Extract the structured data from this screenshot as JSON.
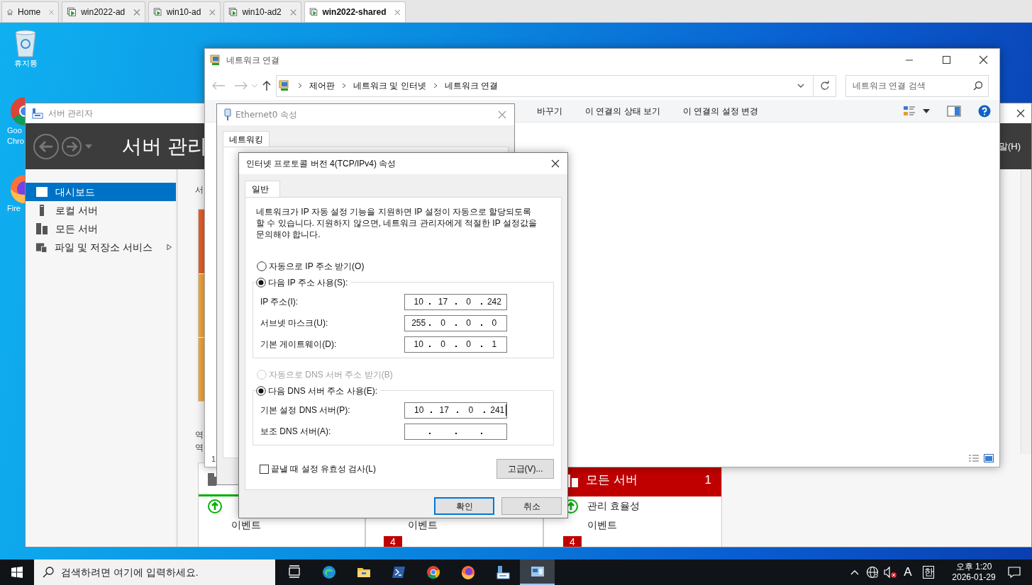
{
  "vm_tabs": [
    {
      "label": "Home",
      "kind": "home",
      "selected": false
    },
    {
      "label": "win2022-ad",
      "kind": "vm",
      "selected": false
    },
    {
      "label": "win10-ad",
      "kind": "vm",
      "selected": false
    },
    {
      "label": "win10-ad2",
      "kind": "vm",
      "selected": false
    },
    {
      "label": "win2022-shared",
      "kind": "vm",
      "selected": true
    }
  ],
  "desktop_icons": [
    {
      "kind": "recycle",
      "lines": [
        "휴지통"
      ]
    },
    {
      "kind": "chrome",
      "lines": [
        "Goo",
        "Chro"
      ]
    },
    {
      "kind": "firefox",
      "lines": [
        "Fire"
      ]
    }
  ],
  "server_manager": {
    "title": "서버 관리자",
    "header_title": "서버 관리",
    "menu_fragment": "말(H)",
    "sidebar": [
      {
        "label": "대시보드",
        "kind": "dashboard",
        "selected": true,
        "expandable": false
      },
      {
        "label": "로컬 서버",
        "kind": "local",
        "selected": false,
        "expandable": false
      },
      {
        "label": "모든 서버",
        "kind": "all",
        "selected": false,
        "expandable": false
      },
      {
        "label": "파일 및 저장소 서비스",
        "kind": "files",
        "selected": false,
        "expandable": true
      }
    ],
    "content_fragments": [
      "서",
      "역",
      "역"
    ],
    "tiles": [
      {
        "kind": "ok",
        "rows": [
          {
            "kind": "status"
          },
          {
            "kind": "plain",
            "text": "이벤트"
          }
        ]
      },
      {
        "kind": "plain",
        "rows": [
          {
            "kind": "plain",
            "text": "이벤트"
          },
          {
            "kind": "badge",
            "badge": "4"
          }
        ]
      },
      {
        "kind": "alert",
        "header": "모든 서버",
        "count": "1",
        "rows": [
          {
            "kind": "status",
            "text": "관리 효율성"
          },
          {
            "kind": "plain",
            "text": "이벤트"
          },
          {
            "kind": "badge",
            "badge": "4"
          }
        ]
      }
    ]
  },
  "network_window": {
    "title": "네트워크 연결",
    "breadcrumb": [
      "제어판",
      "네트워크 및 인터넷",
      "네트워크 연결"
    ],
    "search_placeholder": "네트워크 연결 검색",
    "content_fragment": "1",
    "toolbar": [
      "바꾸기",
      "이 연결의 상태 보기",
      "이 연결의 설정 변경"
    ]
  },
  "ethernet_dialog": {
    "title": "Ethernet0 속성",
    "tabs": [
      {
        "label": "네트워킹",
        "selected": true
      }
    ]
  },
  "ipv4_dialog": {
    "title": "인터넷 프로토콜 버전 4(TCP/IPv4) 속성",
    "tabs": [
      {
        "label": "일반",
        "selected": true
      }
    ],
    "description": "네트워크가 IP 자동 설정 기능을 지원하면 IP 설정이 자동으로 할당되도록 할 수 있습니다. 지원하지 않으면, 네트워크 관리자에게 적절한 IP 설정값을 문의해야 합니다.",
    "ip_modes": [
      {
        "label": "자동으로 IP 주소 받기(O)",
        "selected": false,
        "disabled": false
      },
      {
        "label": "다음 IP 주소 사용(S):",
        "selected": true,
        "disabled": false
      }
    ],
    "ip_fields": [
      {
        "label": "IP 주소(I):",
        "octets": [
          "10",
          "17",
          "0",
          "242"
        ]
      },
      {
        "label": "서브넷 마스크(U):",
        "octets": [
          "255",
          "0",
          "0",
          "0"
        ]
      },
      {
        "label": "기본 게이트웨이(D):",
        "octets": [
          "10",
          "0",
          "0",
          "1"
        ]
      }
    ],
    "dns_modes": [
      {
        "label": "자동으로 DNS 서버 주소 받기(B)",
        "selected": false,
        "disabled": true
      },
      {
        "label": "다음 DNS 서버 주소 사용(E):",
        "selected": true,
        "disabled": false
      }
    ],
    "dns_fields": [
      {
        "label": "기본 설정 DNS 서버(P):",
        "octets": [
          "10",
          "17",
          "0",
          "241"
        ],
        "focused": true
      },
      {
        "label": "보조 DNS 서버(A):",
        "focused": false
      }
    ],
    "validate": {
      "label": "끝낼 때 설정 유효성 검사(L)",
      "checked": false
    },
    "advanced_button": "고급(V)...",
    "buttons": [
      {
        "label": "확인",
        "default": true
      },
      {
        "label": "취소",
        "default": false
      }
    ]
  },
  "taskbar": {
    "search_placeholder": "검색하려면 여기에 입력하세요.",
    "apps": [
      {
        "kind": "taskview",
        "active": false
      },
      {
        "kind": "edge",
        "active": false
      },
      {
        "kind": "explorer",
        "active": false
      },
      {
        "kind": "powershell",
        "active": false
      },
      {
        "kind": "chrome",
        "active": false
      },
      {
        "kind": "firefox",
        "active": false
      },
      {
        "kind": "servermanager",
        "active": false
      },
      {
        "kind": "network",
        "active": true
      }
    ],
    "ime_mode": "A",
    "ime_lang": "한",
    "time": "오후 1:20",
    "date": "2026-01-29"
  }
}
